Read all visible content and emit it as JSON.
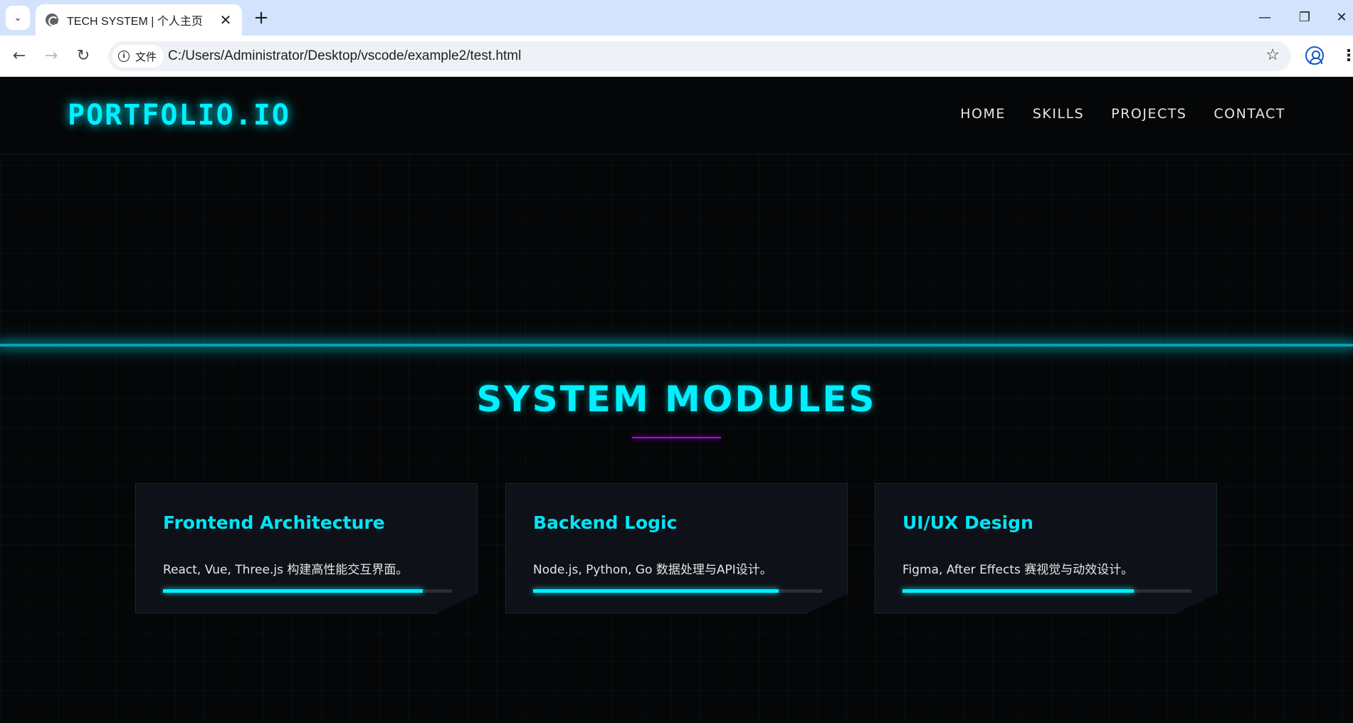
{
  "browser": {
    "tab_title": "TECH SYSTEM | 个人主页",
    "tab_close": "✕",
    "new_tab": "+",
    "site_chip_label": "文件",
    "url": "C:/Users/Administrator/Desktop/vscode/example2/test.html",
    "icons": {
      "tab_search": "chevron-down-icon",
      "favicon": "globe-icon",
      "back": "arrow-left-icon",
      "forward": "arrow-right-icon",
      "reload": "reload-icon",
      "info": "info-icon",
      "bookmark": "star-icon",
      "profile": "profile-icon",
      "menu": "more-vert-icon",
      "minimize": "minimize-icon",
      "restore": "restore-icon",
      "close": "close-icon"
    }
  },
  "site": {
    "logo": "PORTFOLIO.IO",
    "nav": [
      "HOME",
      "SKILLS",
      "PROJECTS",
      "CONTACT"
    ]
  },
  "section": {
    "title": "SYSTEM MODULES"
  },
  "cards": [
    {
      "title": "Frontend Architecture",
      "desc": "React, Vue, Three.js 构建高性能交互界面。",
      "progress": 0.9
    },
    {
      "title": "Backend Logic",
      "desc": "Node.js, Python, Go 数据处理与API设计。",
      "progress": 0.85
    },
    {
      "title": "UI/UX Design",
      "desc": "Figma, After Effects 赛视觉与动效设计。",
      "progress": 0.8
    }
  ],
  "colors": {
    "accent": "#00f0ff",
    "underline": "#b400ff",
    "background": "#050607",
    "card": "#0e1117",
    "chrome_tabstrip": "#d3e3fd"
  }
}
